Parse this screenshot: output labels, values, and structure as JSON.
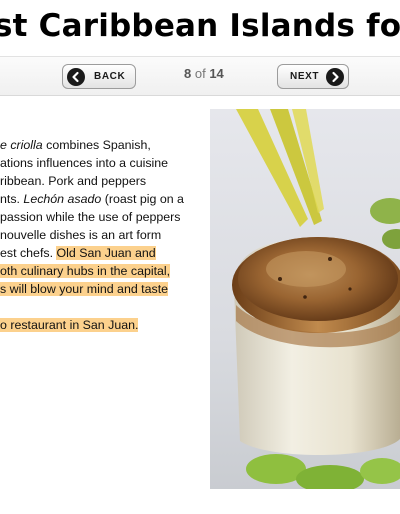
{
  "page": {
    "title": "st Caribbean Islands for Food"
  },
  "nav": {
    "back_label": "BACK",
    "next_label": "NEXT",
    "current": "8",
    "of": "of",
    "total": "14"
  },
  "article": {
    "line1_italic": "e criolla",
    "line1_rest": " combines Spanish,",
    "line2": "ations influences into a cuisine",
    "line3": "ribbean. Pork and peppers",
    "line4_pre": "nts. ",
    "line4_italic": "Lechón asado",
    "line4_post": " (roast pig on a",
    "line5": "passion while the use of peppers",
    "line6": "nouvelle dishes is an art form",
    "line7_plain": "est chefs. ",
    "line7_hl": "Old San Juan and",
    "line8_hl": "oth culinary hubs in the capital,",
    "line9_hl": "s will blow your mind and taste",
    "line10_hl": "o restaurant in San Juan."
  },
  "photo": {
    "subject": "seared-scallop-photo"
  },
  "colors": {
    "highlight": "#fcd18d",
    "button_border": "#9c9c9c",
    "icon_dark": "#1a1a1a"
  }
}
